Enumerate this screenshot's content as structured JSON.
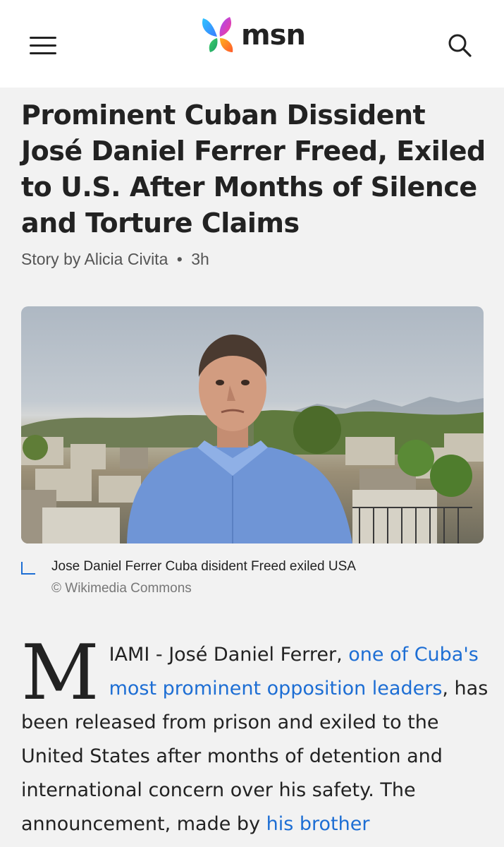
{
  "header": {
    "brand": "msn",
    "menu_icon": "hamburger-menu-icon",
    "search_icon": "search-icon"
  },
  "article": {
    "headline": "Prominent Cuban Dissident José Daniel Ferrer Freed, Exiled to U.S. After Months of Silence and Torture Claims",
    "byline_prefix": "Story by",
    "author": "Alicia Civita",
    "separator": "•",
    "age": "3h",
    "caption": "Jose Daniel Ferrer Cuba disident Freed exiled USA",
    "credit": "© Wikimedia Commons",
    "dropcap": "M",
    "body": {
      "t1": "IAMI - José Daniel Ferrer, ",
      "link1": "one of Cuba's most prominent opposition leaders",
      "t2": ", has been released from prison and exiled to the United States after months of detention and international concern over his safety. The announcement, made by ",
      "link2": "his brother"
    }
  },
  "colors": {
    "link": "#1d6ed4",
    "page_background": "#f2f2f2",
    "header_background": "#ffffff"
  }
}
